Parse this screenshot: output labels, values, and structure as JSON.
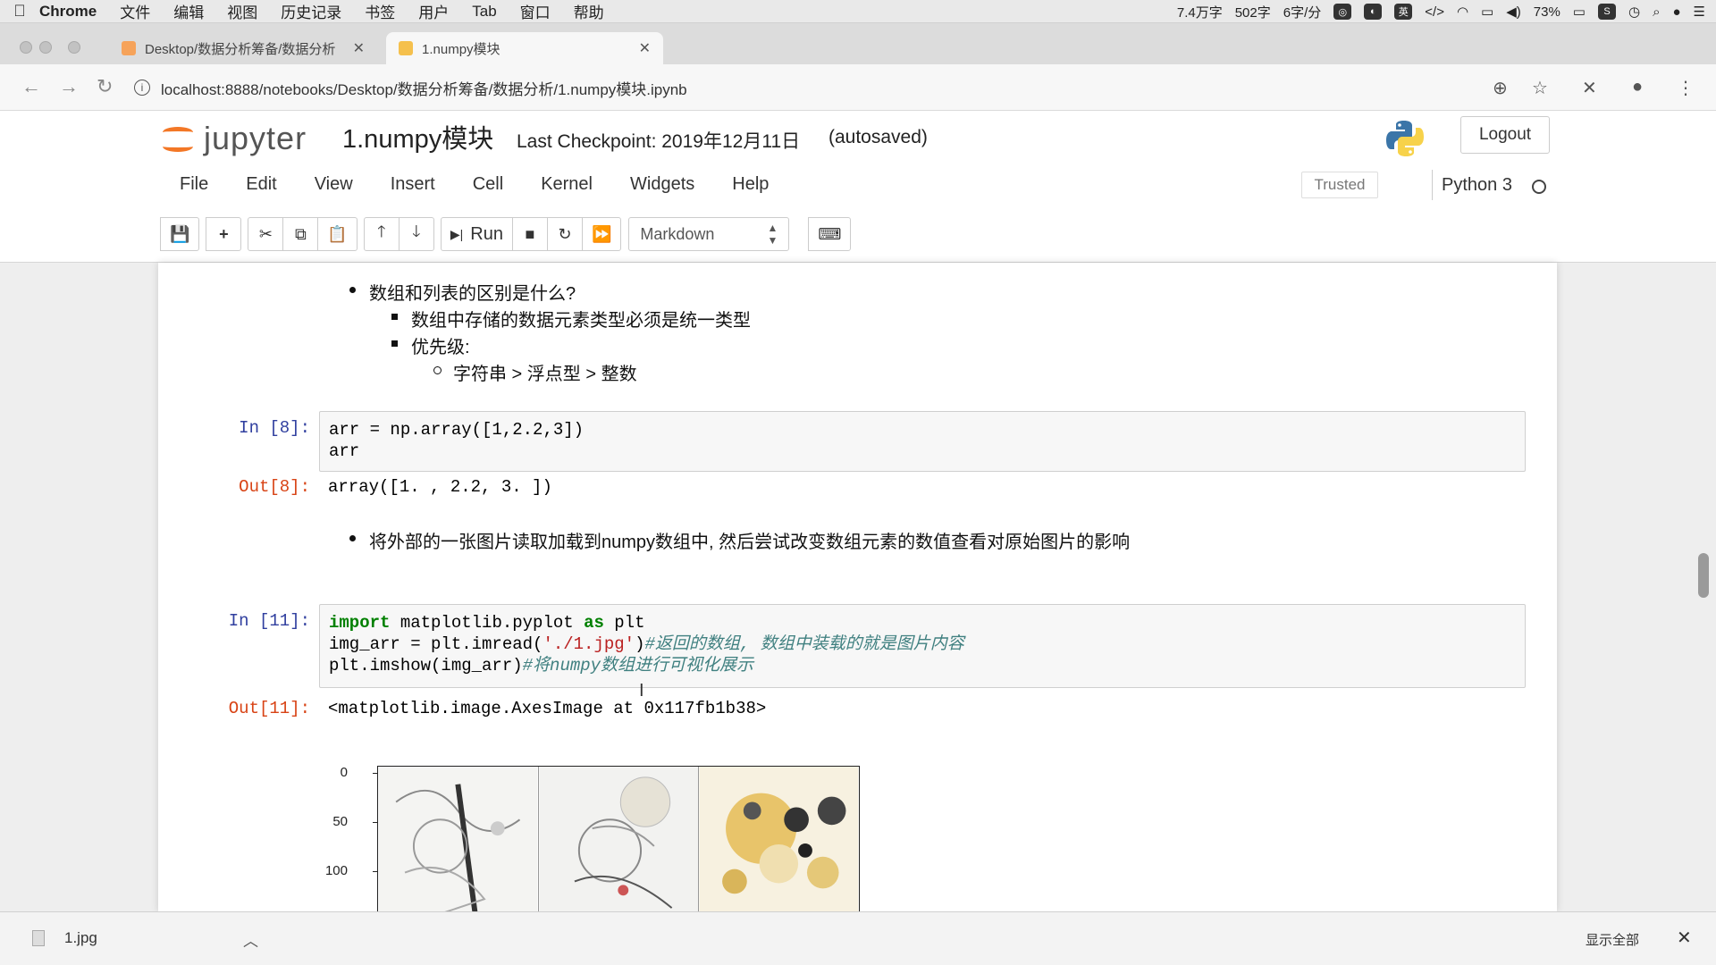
{
  "menubar": {
    "app": "Chrome",
    "items": [
      "文件",
      "编辑",
      "视图",
      "历史记录",
      "书签",
      "用户",
      "Tab",
      "窗口",
      "帮助"
    ],
    "status": [
      "7.4万字",
      "502字",
      "6字/分"
    ],
    "battery": "73%"
  },
  "tabs": [
    {
      "title": "Desktop/数据分析筹备/数据分析",
      "active": false
    },
    {
      "title": "1.numpy模块",
      "active": true
    }
  ],
  "address": {
    "url": "localhost:8888/notebooks/Desktop/数据分析筹备/数据分析/1.numpy模块.ipynb"
  },
  "jupyter": {
    "logo_text": "jupyter",
    "notebook_name": "1.numpy模块",
    "checkpoint": "Last Checkpoint: 2019年12月11日",
    "autosaved": "(autosaved)",
    "logout": "Logout",
    "menus": [
      "File",
      "Edit",
      "View",
      "Insert",
      "Cell",
      "Kernel",
      "Widgets",
      "Help"
    ],
    "trusted": "Trusted",
    "kernel": "Python 3",
    "run_label": "Run",
    "cell_type": "Markdown"
  },
  "cells": {
    "md1": {
      "q": "数组和列表的区别是什么?",
      "a1": "数组中存储的数据元素类型必须是统一类型",
      "a2": "优先级:",
      "a3": "字符串 > 浮点型 > 整数"
    },
    "c8": {
      "in_prompt": "In [8]:",
      "line1": "arr = np.array([1,2.2,3])",
      "line2": "arr",
      "out_prompt": "Out[8]:",
      "output": "array([1. , 2.2, 3. ])"
    },
    "md2": {
      "text": "将外部的一张图片读取加载到numpy数组中, 然后尝试改变数组元素的数值查看对原始图片的影响"
    },
    "c11": {
      "in_prompt": "In [11]:",
      "l1_kw1": "import",
      "l1_mid": " matplotlib.pyplot ",
      "l1_kw2": "as",
      "l1_end": " plt",
      "l2_code": "img_arr = plt.imread(",
      "l2_str": "'./1.jpg'",
      "l2_close": ")",
      "l2_cmt": "#返回的数组, 数组中装载的就是图片内容",
      "l3_code": "plt.imshow(img_arr)",
      "l3_cmt": "#将numpy数组进行可视化展示",
      "out_prompt": "Out[11]:",
      "output": "<matplotlib.image.AxesImage at 0x117fb1b38>"
    },
    "plot": {
      "yticks": [
        "0",
        "50",
        "100"
      ]
    }
  },
  "download_bar": {
    "file": "1.jpg",
    "show_all": "显示全部"
  }
}
